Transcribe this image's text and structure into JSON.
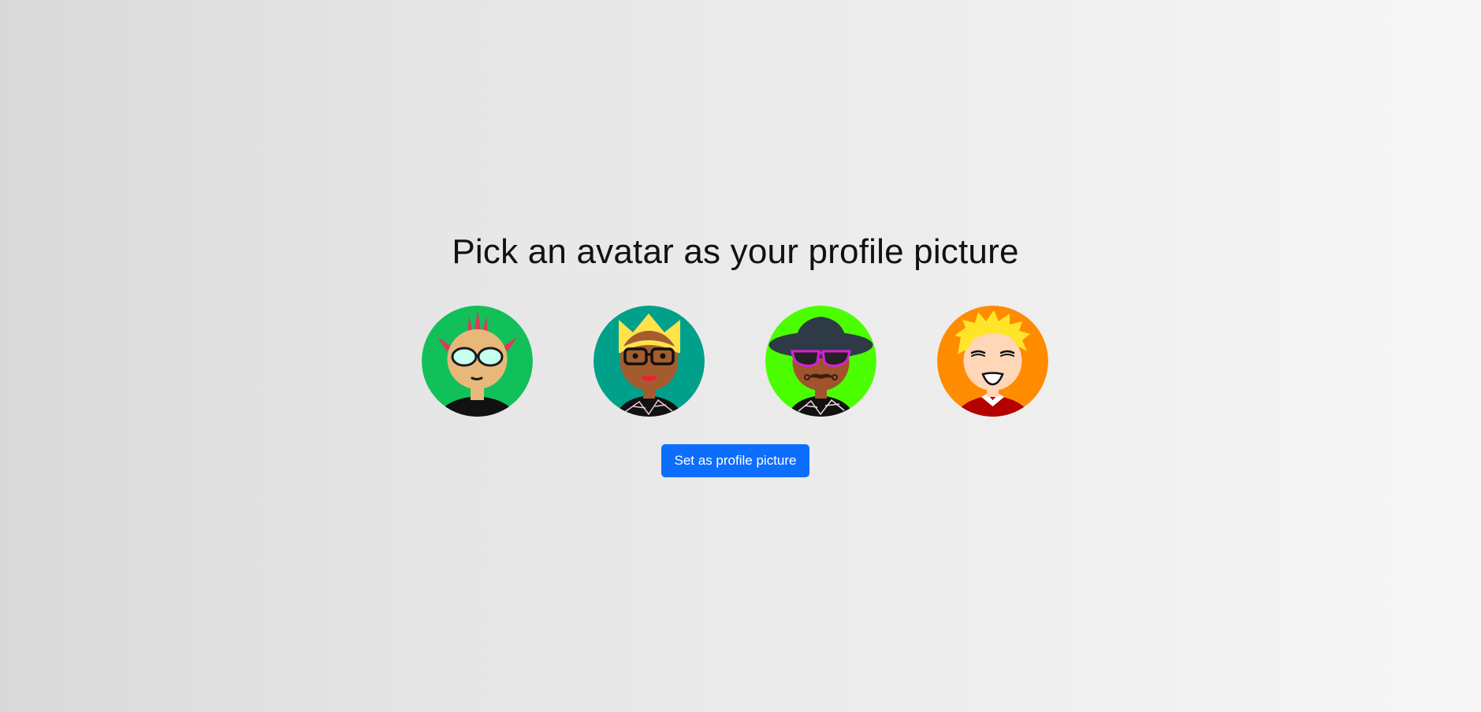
{
  "heading": "Pick an avatar as your profile picture",
  "button_label": "Set as profile picture",
  "accent_color": "#0d6efd",
  "avatars": [
    {
      "name": "punk-avatar",
      "background": "#12c05a",
      "icon": "punk-mohawk-avatar-icon"
    },
    {
      "name": "queen-avatar",
      "background": "#00a08b",
      "icon": "crowned-woman-avatar-icon"
    },
    {
      "name": "fedora-avatar",
      "background": "#4cff00",
      "icon": "fedora-sunglasses-avatar-icon"
    },
    {
      "name": "blonde-avatar",
      "background": "#ff8c00",
      "icon": "blonde-boy-avatar-icon"
    }
  ]
}
